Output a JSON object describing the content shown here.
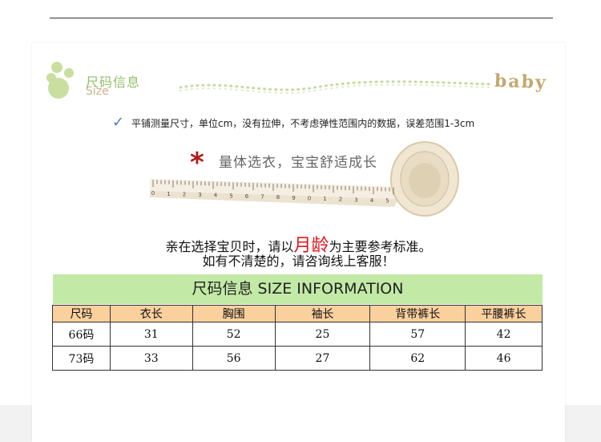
{
  "logo": {
    "cn": "尺码信息",
    "en": "Size",
    "tag": "baby"
  },
  "note": "平铺测量尺寸，单位cm，没有拉伸，不考虑弹性范围内的数据，误差范围1-3cm",
  "slogan": "量体选衣，宝宝舒适成长",
  "tape_numbers": [
    "0",
    "1",
    "2",
    "3",
    "4",
    "5",
    "6",
    "7",
    "8",
    "9",
    "0",
    "1",
    "2",
    "3",
    "4",
    "5"
  ],
  "advice": {
    "line1_pre": "亲在选择宝贝时，请以",
    "line1_highlight": "月龄",
    "line1_post": "为主要参考标准。",
    "line2": "如有不清楚的，请咨询线上客服！"
  },
  "table_title": "尺码信息 SIZE INFORMATION",
  "table": {
    "headers": [
      "尺码",
      "衣长",
      "胸围",
      "袖长",
      "背带裤长",
      "平腰裤长"
    ],
    "rows": [
      [
        "66码",
        "31",
        "52",
        "25",
        "57",
        "42"
      ],
      [
        "73码",
        "33",
        "56",
        "27",
        "62",
        "46"
      ]
    ]
  },
  "colors": {
    "table_header_bg": "#fad09d",
    "title_bar_bg": "#c3e9a6",
    "highlight": "#e5141a",
    "asterisk": "#b11a1a",
    "check": "#4a7fc1"
  }
}
